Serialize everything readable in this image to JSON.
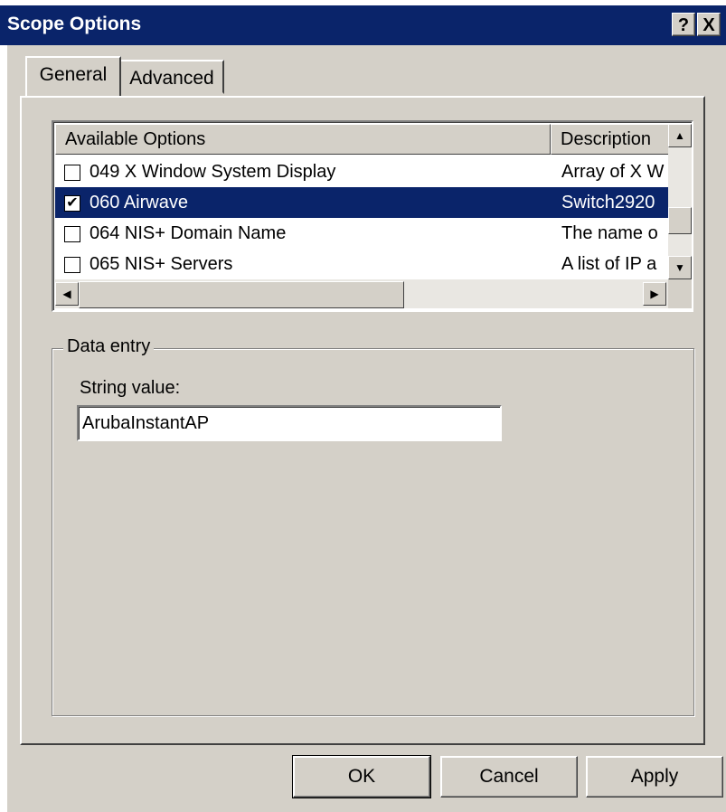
{
  "window": {
    "title": "Scope Options",
    "help_label": "?",
    "close_label": "X"
  },
  "tabs": [
    {
      "label": "General",
      "active": true
    },
    {
      "label": "Advanced",
      "active": false
    }
  ],
  "options_list": {
    "columns": [
      "Available Options",
      "Description"
    ],
    "rows": [
      {
        "checked": false,
        "name": "049 X Window System Display",
        "description": "Array of X W",
        "selected": false
      },
      {
        "checked": true,
        "name": "060 Airwave",
        "description": "Switch2920",
        "selected": true
      },
      {
        "checked": false,
        "name": "064 NIS+ Domain Name",
        "description": "The name o",
        "selected": false
      },
      {
        "checked": false,
        "name": "065 NIS+ Servers",
        "description": "A list of IP a",
        "selected": false
      }
    ]
  },
  "data_entry": {
    "group_label": "Data entry",
    "string_label": "String value:",
    "string_value": "ArubaInstantAP"
  },
  "buttons": {
    "ok": "OK",
    "cancel": "Cancel",
    "apply": "Apply"
  },
  "icons": {
    "scroll_up": "scroll-up-arrow-icon",
    "scroll_down": "scroll-down-arrow-icon",
    "scroll_left": "scroll-left-arrow-icon",
    "scroll_right": "scroll-right-arrow-icon",
    "checkmark": "checkmark-icon"
  },
  "colors": {
    "title_bar": "#0a246a",
    "selection": "#0a246a",
    "dialog_face": "#d4d0c8"
  }
}
